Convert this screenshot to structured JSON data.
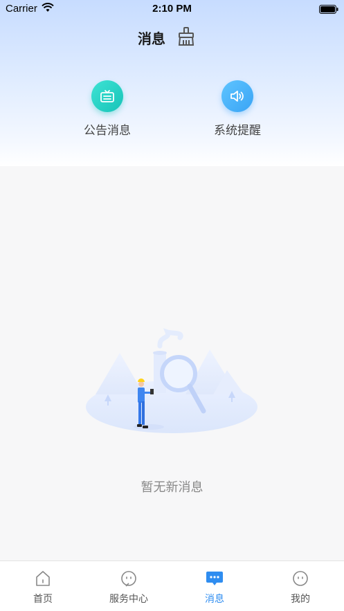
{
  "status_bar": {
    "carrier": "Carrier",
    "time": "2:10 PM"
  },
  "header": {
    "title": "消息",
    "clear_icon": "broom-icon"
  },
  "categories": [
    {
      "label": "公告消息",
      "icon": "announcement-icon",
      "color": "#1fcfc2"
    },
    {
      "label": "系统提醒",
      "icon": "speaker-icon",
      "color": "#46b1f8"
    }
  ],
  "empty_state": {
    "text": "暂无新消息"
  },
  "tab_bar": {
    "items": [
      {
        "label": "首页",
        "icon": "home-icon",
        "active": false
      },
      {
        "label": "服务中心",
        "icon": "face-icon",
        "active": false
      },
      {
        "label": "消息",
        "icon": "chat-bubble-icon",
        "active": true
      },
      {
        "label": "我的",
        "icon": "profile-face-icon",
        "active": false
      }
    ],
    "active_color": "#2f8df0",
    "inactive_color": "#888888"
  }
}
